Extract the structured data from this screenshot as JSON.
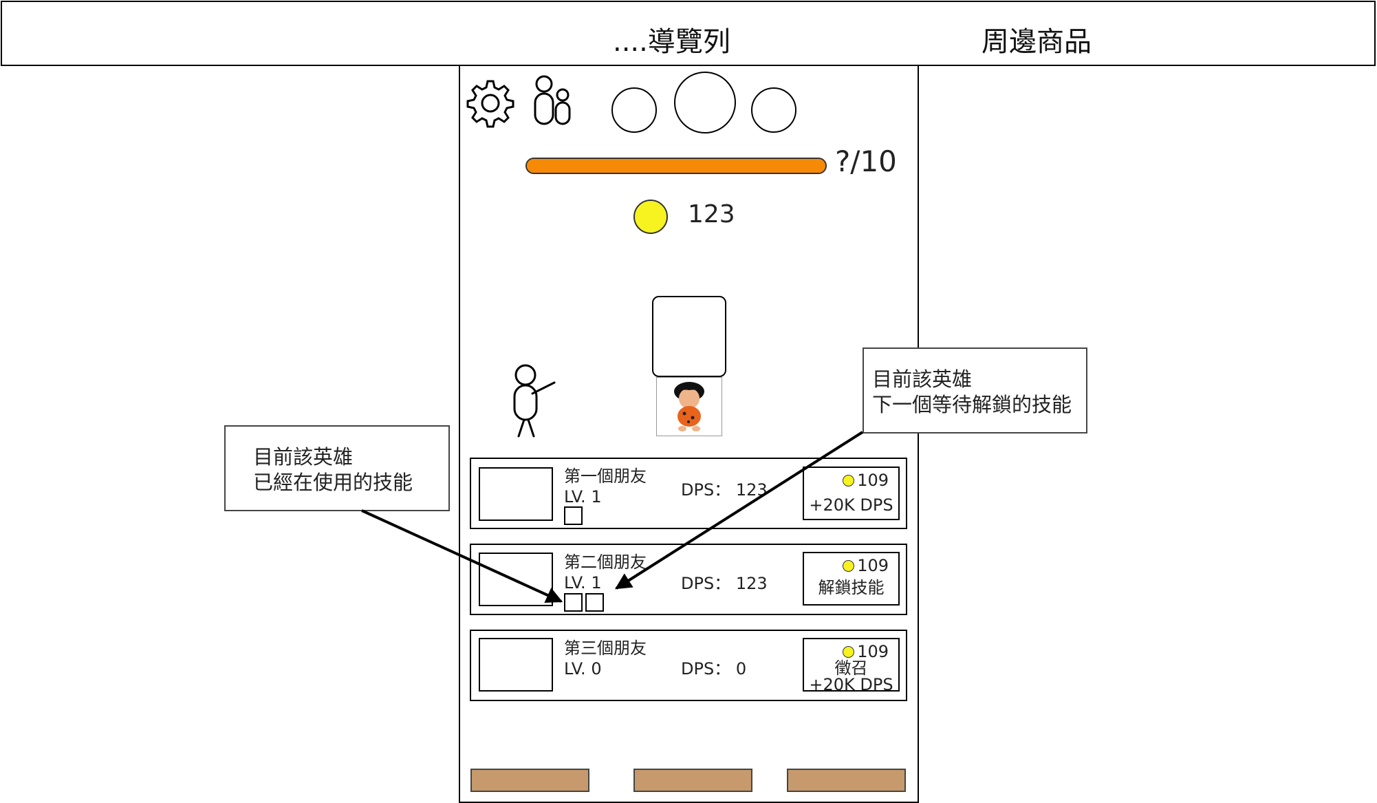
{
  "nav": {
    "menu_label": "....導覽列",
    "merch_label": "周邊商品"
  },
  "top_icons": {
    "settings_icon": "gear-icon",
    "friends_icon": "people-icon"
  },
  "progress": {
    "text": "?/10",
    "fill": 1.0,
    "color": "#f68a06"
  },
  "currency": {
    "amount": "123",
    "coin_color": "#f7f320"
  },
  "heroes": [
    {
      "name": "第一個朋友",
      "level": "LV. 1",
      "dps": "DPS：  123",
      "skills": 1,
      "price": "109",
      "action_lines": [
        "+20K DPS"
      ]
    },
    {
      "name": "第二個朋友",
      "level": "LV. 1",
      "dps": "DPS：  123",
      "skills": 2,
      "price": "109",
      "action_lines": [
        "解鎖技能"
      ]
    },
    {
      "name": "第三個朋友",
      "level": "LV. 0",
      "dps": "DPS：  0",
      "skills": 0,
      "price": "109",
      "action_lines": [
        "徵召",
        "+20K DPS"
      ]
    }
  ],
  "bottom_buttons": {
    "color": "#c69a6c",
    "count": 3
  },
  "annotations": {
    "left": {
      "line1": "目前該英雄",
      "line2": "已經在使用的技能"
    },
    "right": {
      "line1": "目前該英雄",
      "line2": "下一個等待解鎖的技能"
    }
  }
}
